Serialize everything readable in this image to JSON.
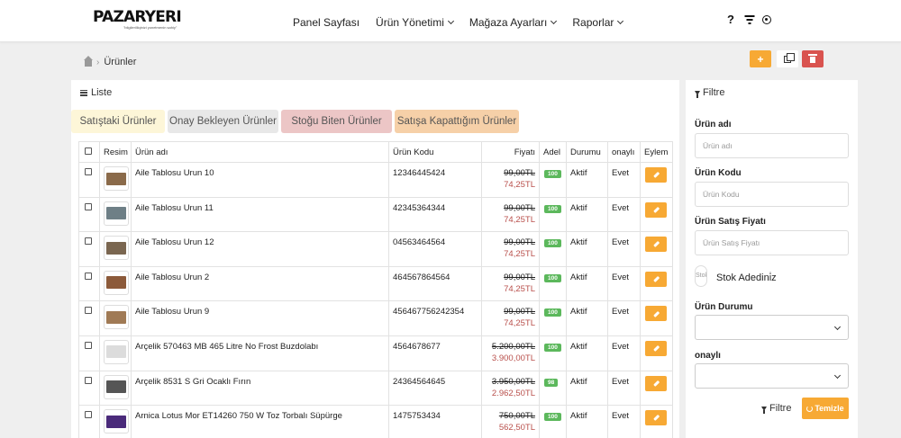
{
  "brand": {
    "name": "PAZARYERI",
    "tagline": "\"bilgilerilliqinizi yonetmenin sahiy\""
  },
  "nav": {
    "items": [
      {
        "label": "Panel Sayfası",
        "dropdown": false
      },
      {
        "label": "Ürün Yönetimi",
        "dropdown": true
      },
      {
        "label": "Mağaza Ayarları",
        "dropdown": true
      },
      {
        "label": "Raporlar",
        "dropdown": true
      }
    ],
    "help_label": "?"
  },
  "breadcrumb": {
    "current": "Ürünler",
    "separator": "›"
  },
  "actions": {
    "add_label": "+"
  },
  "list": {
    "title": "Liste",
    "tabs": [
      "Satıştaki Ürünler",
      "Onay Bekleyen Ürünler",
      "Stoğu Biten Ürünler",
      "Satışa Kapattığım Ürünler"
    ],
    "columns": [
      "Resim",
      "Ürün adı",
      "Ürün Kodu",
      "Fiyatı",
      "Adel",
      "Durumu",
      "onaylı",
      "Eylem"
    ],
    "rows": [
      {
        "name": "Aile Tablosu Urun 10",
        "code": "12346445424",
        "old_price": "99,00TL",
        "new_price": "74,25TL",
        "stock": "100",
        "status": "Aktif",
        "approved": "Evet",
        "thumb": "#8a6a4a"
      },
      {
        "name": "Aile Tablosu Urun 11",
        "code": "42345364344",
        "old_price": "99,00TL",
        "new_price": "74,25TL",
        "stock": "100",
        "status": "Aktif",
        "approved": "Evet",
        "thumb": "#6e7f86"
      },
      {
        "name": "Aile Tablosu Urun 12",
        "code": "04563464564",
        "old_price": "99,00TL",
        "new_price": "74,25TL",
        "stock": "100",
        "status": "Aktif",
        "approved": "Evet",
        "thumb": "#7a6650"
      },
      {
        "name": "Aile Tablosu Urun 2",
        "code": "464567864564",
        "old_price": "99,00TL",
        "new_price": "74,25TL",
        "stock": "100",
        "status": "Aktif",
        "approved": "Evet",
        "thumb": "#8c5a3a"
      },
      {
        "name": "Aile Tablosu Urun 9",
        "code": "456467756242354",
        "old_price": "99,00TL",
        "new_price": "74,25TL",
        "stock": "100",
        "status": "Aktif",
        "approved": "Evet",
        "thumb": "#a07a55"
      },
      {
        "name": "Arçelik 570463 MB 465 Litre No Frost Buzdolabı",
        "code": "4564678677",
        "old_price": "5.200,00TL",
        "new_price": "3.900,00TL",
        "stock": "100",
        "status": "Aktif",
        "approved": "Evet",
        "thumb": "#dcdcdc"
      },
      {
        "name": "Arçelik 8531 S Gri Ocaklı Fırın",
        "code": "24364564645",
        "old_price": "3.950,00TL",
        "new_price": "2.962,50TL",
        "stock": "98",
        "status": "Aktif",
        "approved": "Evet",
        "thumb": "#555555"
      },
      {
        "name": "Arnica Lotus Mor ET14260 750 W Toz Torbalı Süpürge",
        "code": "1475753434",
        "old_price": "750,00TL",
        "new_price": "562,50TL",
        "stock": "100",
        "status": "Aktif",
        "approved": "Evet",
        "thumb": "#4a2a7a"
      }
    ]
  },
  "filter": {
    "title": "Filtre",
    "fields": [
      {
        "label": "Ürün adı",
        "placeholder": "Ürün adı"
      },
      {
        "label": "Ürün Kodu",
        "placeholder": "Ürün Kodu"
      },
      {
        "label": "Ürün Satış Fiyatı",
        "placeholder": "Ürün Satış Fiyatı"
      }
    ],
    "stock_placeholder": "Stok",
    "stock_label": "Stok Adedini̇z",
    "status_label": "Ürün Durumu",
    "approved_label": "onaylı",
    "filter_button": "Filtre",
    "clear_button": "Temizle"
  }
}
